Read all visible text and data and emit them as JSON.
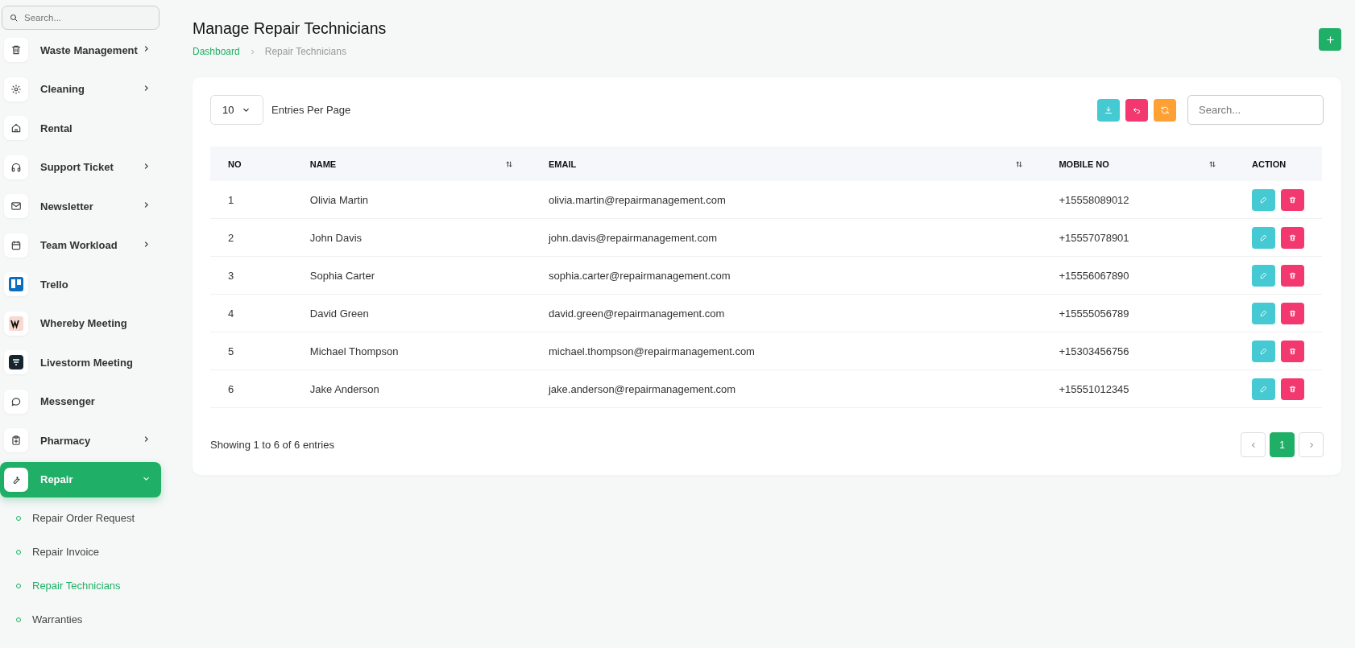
{
  "sidebar": {
    "search": {
      "placeholder": "Search..."
    },
    "items": [
      {
        "label": "Waste Management",
        "expanded": false,
        "selected": false
      },
      {
        "label": "Cleaning",
        "expanded": false,
        "selected": false
      },
      {
        "label": "Rental",
        "selected": false
      },
      {
        "label": "Support Ticket",
        "expanded": false,
        "selected": false
      },
      {
        "label": "Newsletter",
        "expanded": false,
        "selected": false
      },
      {
        "label": "Team Workload",
        "expanded": false,
        "selected": false
      },
      {
        "label": "Trello",
        "selected": false
      },
      {
        "label": "Whereby Meeting",
        "selected": false
      },
      {
        "label": "Livestorm Meeting",
        "selected": false
      },
      {
        "label": "Messenger",
        "selected": false
      },
      {
        "label": "Pharmacy",
        "expanded": false,
        "selected": false
      },
      {
        "label": "Repair",
        "expanded": true,
        "selected": true,
        "children": [
          {
            "label": "Repair Order Request",
            "selected": false
          },
          {
            "label": "Repair Invoice",
            "selected": false
          },
          {
            "label": "Repair Technicians",
            "selected": true
          },
          {
            "label": "Warranties",
            "selected": false
          }
        ]
      }
    ]
  },
  "page": {
    "title": "Manage Repair Technicians",
    "breadcrumb": [
      {
        "label": "Dashboard",
        "selected": false
      },
      {
        "label": "Repair Technicians",
        "selected": true
      }
    ]
  },
  "toolbar": {
    "entries_select": "10",
    "entries_label": "Entries Per Page",
    "search": {
      "placeholder": "Search..."
    }
  },
  "table": {
    "columns": [
      {
        "label": "NO",
        "sortable": false
      },
      {
        "label": "NAME",
        "sortable": true
      },
      {
        "label": "EMAIL",
        "sortable": true
      },
      {
        "label": "MOBILE NO",
        "sortable": true
      },
      {
        "label": "ACTION",
        "sortable": false
      }
    ],
    "rows": [
      [
        "1",
        "Olivia Martin",
        "olivia.martin@repairmanagement.com",
        "+15558089012"
      ],
      [
        "2",
        "John Davis",
        "john.davis@repairmanagement.com",
        "+15557078901"
      ],
      [
        "3",
        "Sophia Carter",
        "sophia.carter@repairmanagement.com",
        "+15556067890"
      ],
      [
        "4",
        "David Green",
        "david.green@repairmanagement.com",
        "+15555056789"
      ],
      [
        "5",
        "Michael Thompson",
        "michael.thompson@repairmanagement.com",
        "+15303456756"
      ],
      [
        "6",
        "Jake Anderson",
        "jake.anderson@repairmanagement.com",
        "+15551012345"
      ]
    ]
  },
  "footer": {
    "summary": "Showing 1 to 6 of 6 entries",
    "pages": [
      {
        "label": "1",
        "selected": true
      }
    ]
  }
}
